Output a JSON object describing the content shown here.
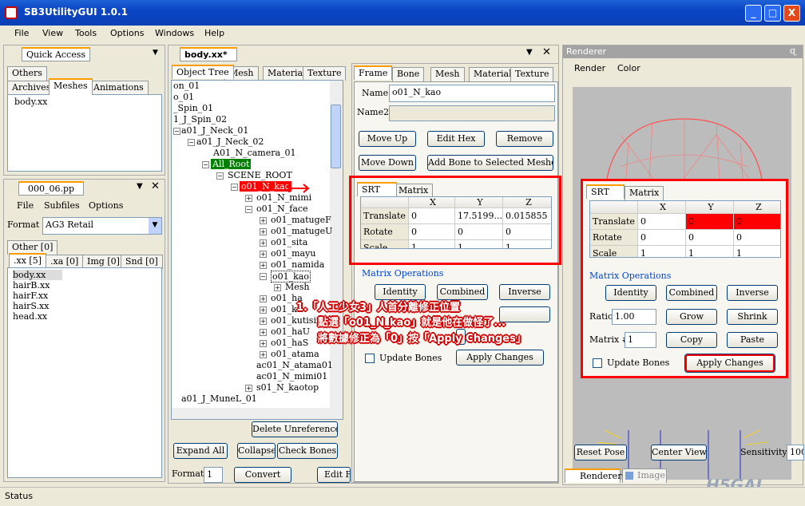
{
  "window": {
    "title": "SB3UtilityGUI 1.0.1",
    "min": "_",
    "max": "□",
    "close": "X"
  },
  "menu": [
    "File",
    "View",
    "Tools",
    "Options",
    "Windows",
    "Help"
  ],
  "quick": {
    "title": "Quick Access",
    "tabs": [
      "Others",
      "Archives",
      "Meshes",
      "Animations"
    ],
    "items": [
      "body.xx"
    ]
  },
  "pp": {
    "title": "000_06.pp",
    "menu": [
      "File",
      "Subfiles",
      "Options"
    ],
    "format_label": "Format",
    "format_value": "AG3 Retail",
    "tab_other": "Other [0]",
    "tabs": [
      ".xx [5]",
      ".xa [0]",
      "Img [0]",
      "Snd [0]"
    ],
    "files": [
      "body.xx",
      "hairB.xx",
      "hairF.xx",
      "hairS.xx",
      "head.xx"
    ]
  },
  "doc": {
    "title": "body.xx*",
    "tabs": [
      "Object Tree",
      "Mesh",
      "Material",
      "Texture"
    ],
    "tree": [
      "on_01",
      "o_01",
      "_Spin_01",
      "1_J_Spin_02",
      "a01_J_Neck_01",
      "a01_J_Neck_02",
      "A01_N_camera_01",
      "All_Root",
      "SCENE_ROOT",
      "o01_N_kao",
      "o01_N_mimi",
      "o01_N_face",
      "o01_matugeF",
      "o01_matugeU",
      "o01_sita",
      "o01_mayu",
      "o01_namida",
      "o01_kao",
      "Mesh",
      "o01_ha",
      "o01_ku",
      "o01_kutisin",
      "o01_haU",
      "o01_haS",
      "o01_atama",
      "ac01_N_atama01",
      "ac01_N_mimi01",
      "s01_N_kaotop",
      "a01_J_MuneL_01"
    ],
    "del_unref": "Delete Unreferenced",
    "expand": "Expand All",
    "collapse": "Collapse",
    "check_bones": "Check Bones",
    "format_label": "Format",
    "format_value": "1",
    "convert": "Convert",
    "edit": "Edit F"
  },
  "frame": {
    "tabs": [
      "Frame",
      "Bone",
      "Mesh",
      "Material",
      "Texture"
    ],
    "name_label": "Name",
    "name_value": "o01_N_kao",
    "name2_label": "Name2",
    "name2_value": "",
    "move_up": "Move Up",
    "edit_hex": "Edit Hex",
    "remove": "Remove",
    "move_down": "Move Down",
    "add_bone": "Add Bone to Selected Meshes",
    "srt_tabs": [
      "SRT",
      "Matrix"
    ],
    "cols": [
      "X",
      "Y",
      "Z"
    ],
    "rows": [
      {
        "label": "Translate",
        "x": "0",
        "y": "17.5199...",
        "z": "0.015855"
      },
      {
        "label": "Rotate",
        "x": "0",
        "y": "0",
        "z": "0"
      },
      {
        "label": "Scale",
        "x": "1",
        "y": "1",
        "z": "1"
      }
    ],
    "matops": "Matrix Operations",
    "identity": "Identity",
    "combined": "Combined",
    "inverse": "Inverse",
    "update_bones": "Update Bones",
    "apply": "Apply Changes"
  },
  "zoom": {
    "srt_tabs": [
      "SRT",
      "Matrix"
    ],
    "cols": [
      "X",
      "Y",
      "Z"
    ],
    "rows": [
      {
        "label": "Translate",
        "x": "0",
        "y": "0",
        "z": "0"
      },
      {
        "label": "Rotate",
        "x": "0",
        "y": "0",
        "z": "0"
      },
      {
        "label": "Scale",
        "x": "1",
        "y": "1",
        "z": "1"
      }
    ],
    "matops": "Matrix Operations",
    "identity": "Identity",
    "combined": "Combined",
    "inverse": "Inverse",
    "ratio_label": "Ratio",
    "ratio_value": "1.00",
    "grow": "Grow",
    "shrink": "Shrink",
    "matrix_label": "Matrix #",
    "matrix_value": "1",
    "copy": "Copy",
    "paste": "Paste",
    "update_bones": "Update Bones",
    "apply": "Apply Changes"
  },
  "annotation": [
    "1.「人工少女3」人首分離修正位置",
    "點選「o01_N_kao」就是他在做怪了...",
    "將數據修正為「0」按「Apply Changes」"
  ],
  "renderer": {
    "title": "Renderer",
    "pin": "ɋ",
    "menu": [
      "Render",
      "Color"
    ],
    "reset_pose": "Reset Pose",
    "center_view": "Center View",
    "sensitivity_label": "Sensitivity",
    "sensitivity_value": "100",
    "tabs": [
      "Renderer",
      "Image"
    ]
  },
  "status": "Status",
  "watermark": "H5GAL",
  "colors": {
    "highlight_red": "#ff0000",
    "tree_selected_green": "#008000",
    "annot_red": "#d00000"
  }
}
